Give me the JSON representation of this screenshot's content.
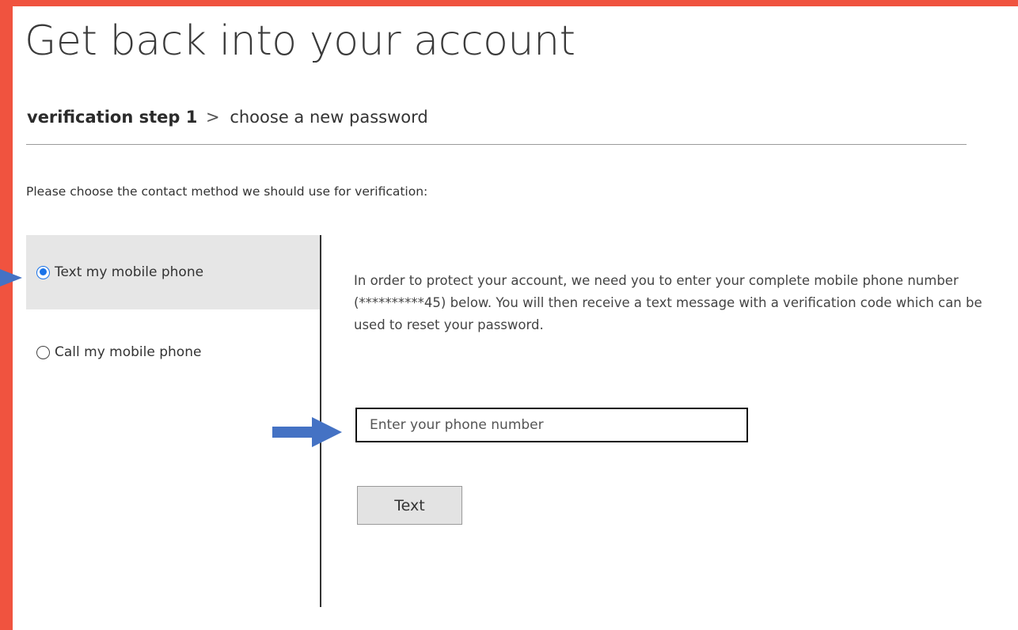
{
  "page": {
    "title": "Get back into your account"
  },
  "breadcrumb": {
    "current_step": "verification step 1",
    "separator": ">",
    "next_step": "choose a new password"
  },
  "instruction": "Please choose the contact method we should use for verification:",
  "methods": [
    {
      "label": "Text my mobile phone",
      "selected": true
    },
    {
      "label": "Call my mobile phone",
      "selected": false
    }
  ],
  "details": {
    "description": "In order to protect your account, we need you to enter your complete mobile phone number (**********45) below. You will then receive a text message with a verification code which can be used to reset your password."
  },
  "phone_input": {
    "placeholder": "Enter your phone number",
    "value": ""
  },
  "text_button": {
    "label": "Text"
  },
  "colors": {
    "frame": "#f0533f",
    "annotation_arrow": "#4472c4",
    "radio_selected": "#1a73e8",
    "selected_option_bg": "#e6e6e6"
  },
  "annotations": [
    {
      "icon": "arrow-right-icon",
      "points_to": "text-my-mobile-phone-option"
    },
    {
      "icon": "arrow-right-icon",
      "points_to": "phone-number-input"
    }
  ]
}
